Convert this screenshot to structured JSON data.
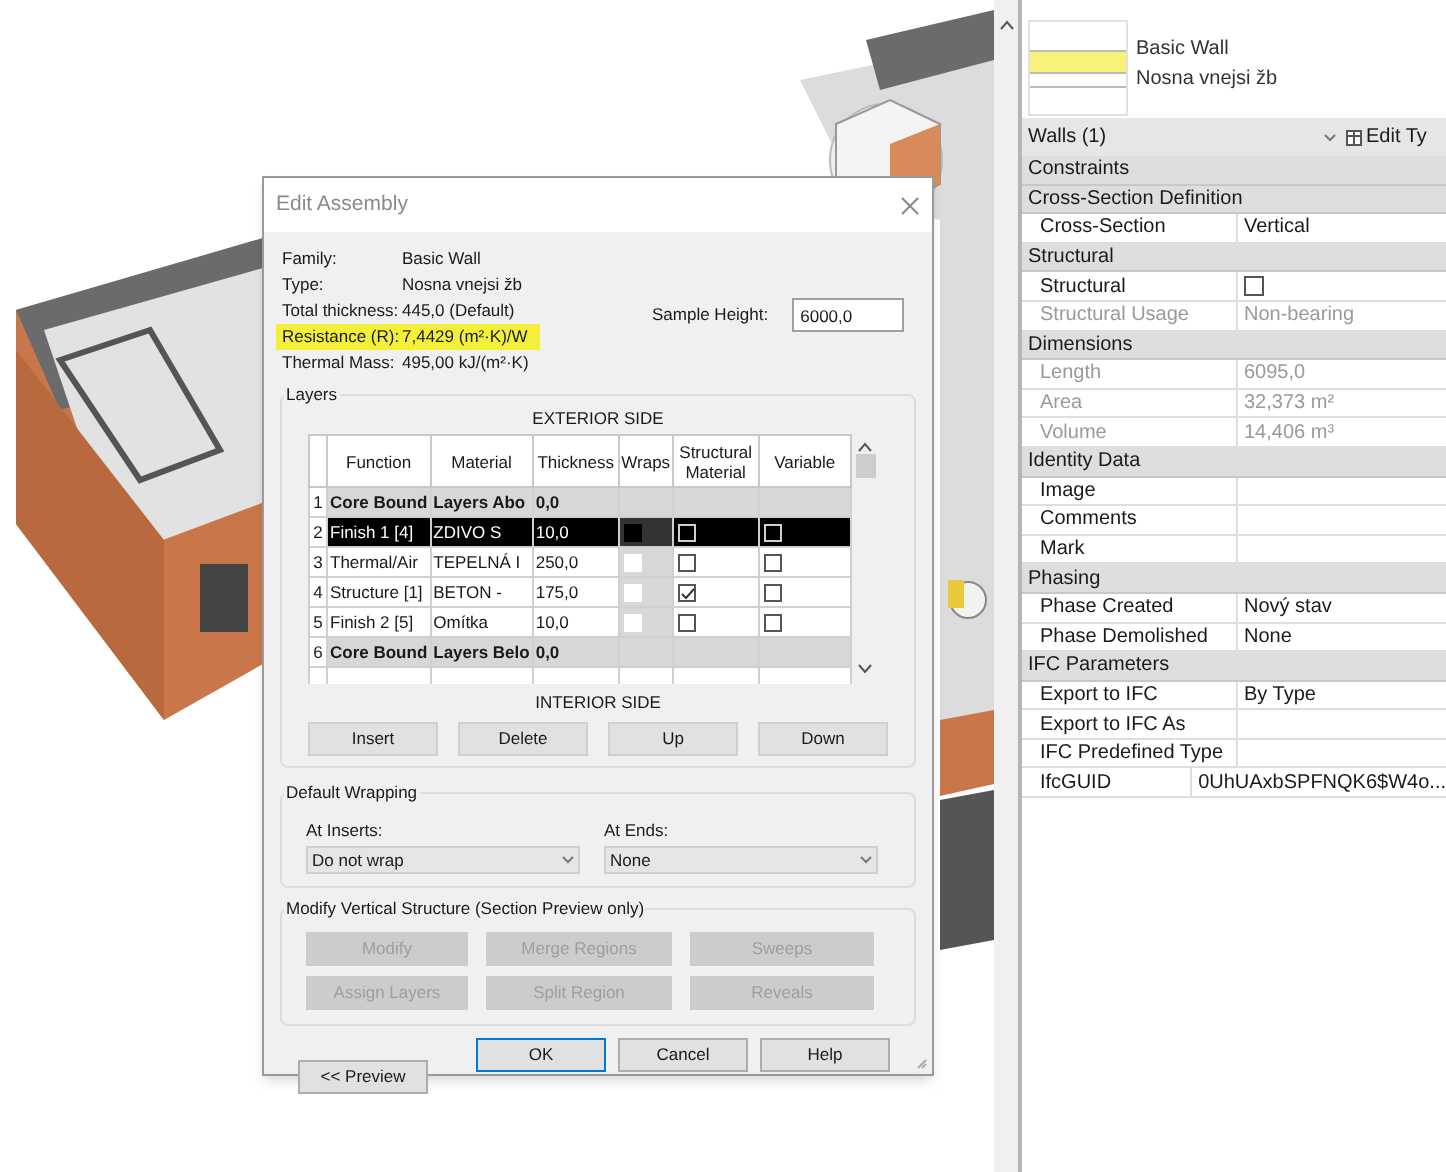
{
  "dialog": {
    "title": "Edit Assembly",
    "info": [
      {
        "label": "Family:",
        "value": "Basic Wall",
        "highlighted": false
      },
      {
        "label": "Type:",
        "value": "Nosna vnejsi žb",
        "highlighted": false
      },
      {
        "label": "Total thickness:",
        "value": "445,0 (Default)",
        "highlighted": false
      },
      {
        "label": "Resistance (R):",
        "value": "7,4429 (m²·K)/W",
        "highlighted": true
      },
      {
        "label": "Thermal Mass:",
        "value": "495,00 kJ/(m²·K)",
        "highlighted": false
      }
    ],
    "sample_height": {
      "label": "Sample Height:",
      "value": "6000,0"
    },
    "layers": {
      "title": "Layers",
      "exterior_label": "EXTERIOR SIDE",
      "interior_label": "INTERIOR SIDE",
      "columns": [
        "Function",
        "Material",
        "Thickness",
        "Wraps",
        "Structural Material",
        "Variable"
      ],
      "rows": [
        {
          "number": "1",
          "kind": "core",
          "function": "Core Bound",
          "material": "Layers Abo",
          "thickness": "0,0",
          "selected": false
        },
        {
          "number": "2",
          "kind": "layer",
          "function": "Finish 1 [4]",
          "material": "ZDIVO S",
          "thickness": "10,0",
          "structural_material": false,
          "variable": false,
          "selected": true
        },
        {
          "number": "3",
          "kind": "layer",
          "function": "Thermal/Air",
          "material": "TEPELNÁ I",
          "thickness": "250,0",
          "structural_material": false,
          "variable": false,
          "selected": false
        },
        {
          "number": "4",
          "kind": "layer",
          "function": "Structure [1]",
          "material": "BETON -",
          "thickness": "175,0",
          "structural_material": true,
          "variable": false,
          "selected": false
        },
        {
          "number": "5",
          "kind": "layer",
          "function": "Finish 2 [5]",
          "material": "Omítka",
          "thickness": "10,0",
          "structural_material": false,
          "variable": false,
          "selected": false
        },
        {
          "number": "6",
          "kind": "core",
          "function": "Core Bound",
          "material": "Layers Belo",
          "thickness": "0,0",
          "selected": false
        }
      ],
      "buttons": [
        "Insert",
        "Delete",
        "Up",
        "Down"
      ]
    },
    "default_wrapping": {
      "title": "Default Wrapping",
      "at_inserts": {
        "label": "At Inserts:",
        "value": "Do not wrap"
      },
      "at_ends": {
        "label": "At  Ends:",
        "value": "None"
      }
    },
    "modify_vertical": {
      "title": "Modify Vertical Structure (Section Preview only)",
      "buttons": [
        {
          "label": "Modify",
          "disabled": true
        },
        {
          "label": "Merge Regions",
          "disabled": true
        },
        {
          "label": "Sweeps",
          "disabled": true
        },
        {
          "label": "Assign Layers",
          "disabled": true
        },
        {
          "label": "Split Region",
          "disabled": true
        },
        {
          "label": "Reveals",
          "disabled": true
        }
      ]
    },
    "footer_buttons": [
      {
        "label": "OK",
        "default": true
      },
      {
        "label": "Cancel",
        "default": false
      },
      {
        "label": "Help",
        "default": false
      }
    ],
    "preview_button": "<< Preview"
  },
  "properties": {
    "type_family": "Basic Wall",
    "type_name": "Nosna vnejsi žb",
    "selector": "Walls (1)",
    "edit_type_button": "Edit Ty",
    "rows": [
      {
        "kind": "section",
        "label": "Constraints"
      },
      {
        "kind": "section",
        "label": "Cross-Section Definition"
      },
      {
        "kind": "property",
        "label": "Cross-Section",
        "value": "Vertical",
        "disabled": false
      },
      {
        "kind": "section",
        "label": "Structural"
      },
      {
        "kind": "checkbox",
        "label": "Structural",
        "checked": false
      },
      {
        "kind": "property",
        "label": "Structural Usage",
        "value": "Non-bearing",
        "disabled": true
      },
      {
        "kind": "section",
        "label": "Dimensions"
      },
      {
        "kind": "property",
        "label": "Length",
        "value": "6095,0",
        "disabled": true
      },
      {
        "kind": "property",
        "label": "Area",
        "value": "32,373 m²",
        "disabled": true
      },
      {
        "kind": "property",
        "label": "Volume",
        "value": "14,406 m³",
        "disabled": true
      },
      {
        "kind": "section",
        "label": "Identity Data"
      },
      {
        "kind": "property",
        "label": "Image",
        "disabled": false
      },
      {
        "kind": "property",
        "label": "Comments",
        "disabled": false
      },
      {
        "kind": "property",
        "label": "Mark",
        "disabled": false
      },
      {
        "kind": "section",
        "label": "Phasing"
      },
      {
        "kind": "property",
        "label": "Phase Created",
        "value": "Nový stav",
        "disabled": false
      },
      {
        "kind": "property",
        "label": "Phase Demolished",
        "value": "None",
        "disabled": false
      },
      {
        "kind": "section",
        "label": "IFC Parameters"
      },
      {
        "kind": "property",
        "label": "Export to IFC",
        "value": "By Type",
        "disabled": false
      },
      {
        "kind": "property",
        "label": "Export to IFC As",
        "disabled": false
      },
      {
        "kind": "property",
        "label": "IFC Predefined Type",
        "disabled": false
      },
      {
        "kind": "property",
        "label": "IfcGUID",
        "value": "0UhUAxbSPFNQK6$W4o...",
        "disabled": false
      }
    ]
  }
}
